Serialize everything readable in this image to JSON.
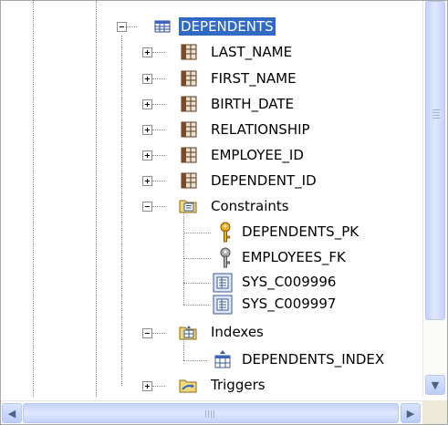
{
  "tree": {
    "nodes": [
      {
        "key": "dependents",
        "label": "DEPENDENTS",
        "icon": "table-icon",
        "expander": "collapse",
        "selected": true
      },
      {
        "key": "last_name",
        "label": "LAST_NAME",
        "icon": "column-icon",
        "expander": "expand"
      },
      {
        "key": "first_name",
        "label": "FIRST_NAME",
        "icon": "column-icon",
        "expander": "expand"
      },
      {
        "key": "birth_date",
        "label": "BIRTH_DATE",
        "icon": "column-icon",
        "expander": "expand"
      },
      {
        "key": "relationship",
        "label": "RELATIONSHIP",
        "icon": "column-icon",
        "expander": "expand"
      },
      {
        "key": "employee_id",
        "label": "EMPLOYEE_ID",
        "icon": "column-icon",
        "expander": "expand"
      },
      {
        "key": "dependent_id",
        "label": "DEPENDENT_ID",
        "icon": "column-icon",
        "expander": "expand"
      },
      {
        "key": "constraints",
        "label": "Constraints",
        "icon": "constraints-folder-icon",
        "expander": "collapse"
      },
      {
        "key": "dependents_pk",
        "label": "DEPENDENTS_PK",
        "icon": "primary-key-icon",
        "expander": "none"
      },
      {
        "key": "employees_fk",
        "label": "EMPLOYEES_FK",
        "icon": "foreign-key-icon",
        "expander": "none"
      },
      {
        "key": "sys_c009996",
        "label": "SYS_C009996",
        "icon": "check-constraint-icon",
        "expander": "none"
      },
      {
        "key": "sys_c009997",
        "label": "SYS_C009997",
        "icon": "check-constraint-icon",
        "expander": "none"
      },
      {
        "key": "indexes",
        "label": "Indexes",
        "icon": "indexes-folder-icon",
        "expander": "collapse"
      },
      {
        "key": "dependents_index",
        "label": "DEPENDENTS_INDEX",
        "icon": "index-icon",
        "expander": "none"
      },
      {
        "key": "triggers",
        "label": "Triggers",
        "icon": "triggers-folder-icon",
        "expander": "expand"
      }
    ]
  },
  "scrollbars": {
    "vertical": {
      "up_icon": "arrow-up-icon",
      "down_icon": "arrow-down-icon",
      "thumb_fraction": 0.82
    },
    "horizontal": {
      "left_icon": "arrow-left-icon",
      "right_icon": "arrow-right-icon",
      "thumb_fraction": 0.92
    }
  },
  "colors": {
    "selection": "#316ac5",
    "scroll_thumb": "#c6d3f7"
  }
}
